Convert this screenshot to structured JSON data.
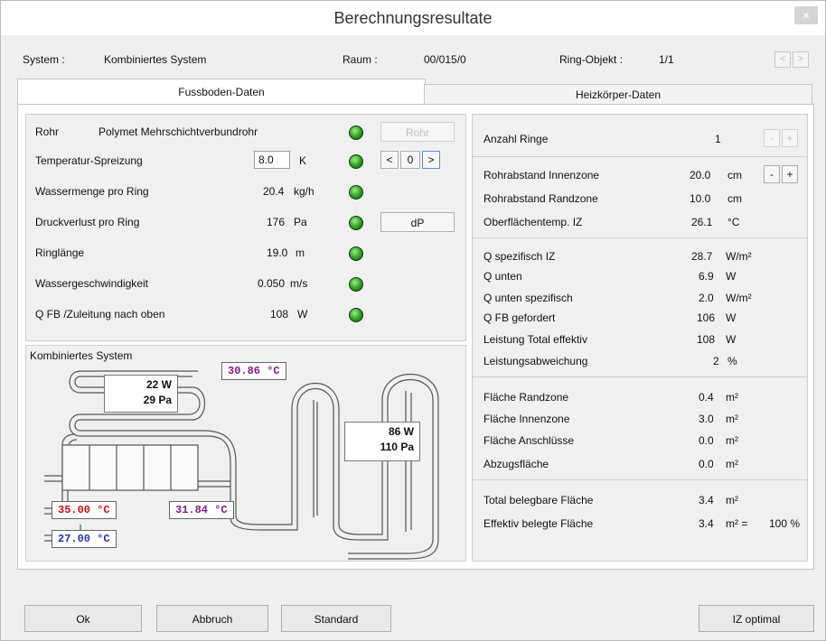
{
  "window": {
    "title": "Berechnungsresultate",
    "close_glyph": "×"
  },
  "infobar": {
    "system_label": "System :",
    "system_value": "Kombiniertes System",
    "raum_label": "Raum :",
    "raum_value": "00/015/0",
    "ring_label": "Ring-Objekt :",
    "ring_value": "1/1",
    "prev": "<",
    "next": ">"
  },
  "tabs": [
    {
      "label": "Fussboden-Daten",
      "active": true
    },
    {
      "label": "Heizkörper-Daten",
      "active": false
    }
  ],
  "left": {
    "rohr_label": "Rohr",
    "rohr_value": "Polymet Mehrschichtverbundrohr",
    "rohr_button": "Rohr",
    "temp_label": "Temperatur-Spreizung",
    "temp_value": "8.0",
    "temp_unit": "K",
    "stepper_prev": "<",
    "stepper_value": "0",
    "stepper_next": ">",
    "wasser_label": "Wassermenge pro Ring",
    "wasser_value": "20.4",
    "wasser_unit": "kg/h",
    "druck_label": "Druckverlust pro Ring",
    "druck_value": "176",
    "druck_unit": "Pa",
    "dp_button": "dP",
    "ring_label": "Ringlänge",
    "ring_value": "19.0",
    "ring_unit": "m",
    "geschw_label": "Wassergeschwindigkeit",
    "geschw_value": "0.050",
    "geschw_unit": "m/s",
    "qfb_label": "Q FB /Zuleitung nach oben",
    "qfb_value": "108",
    "qfb_unit": "W"
  },
  "diagram": {
    "title": "Kombiniertes System",
    "box1_w": "22 W",
    "box1_pa": "29 Pa",
    "box2_w": "86 W",
    "box2_pa": "110 Pa",
    "temp_top": "30.86 °C",
    "temp_supply": "35.00 °C",
    "temp_mid": "31.84 °C",
    "temp_return": "27.00 °C",
    "color_magenta": "#8a1a8a",
    "color_red": "#cc1111",
    "color_blue": "#2233aa"
  },
  "right": {
    "anzahl_label": "Anzahl Ringe",
    "anzahl_value": "1",
    "minus": "-",
    "plus": "+",
    "abstand_innen_label": "Rohrabstand Innenzone",
    "abstand_innen_value": "20.0",
    "abstand_innen_unit": "cm",
    "abstand_rand_label": "Rohrabstand Randzone",
    "abstand_rand_value": "10.0",
    "abstand_rand_unit": "cm",
    "oberfl_label": "Oberflächentemp. IZ",
    "oberfl_value": "26.1",
    "oberfl_unit": "°C",
    "q_spez_label": "Q spezifisch IZ",
    "q_spez_value": "28.7",
    "q_spez_unit": "W/m²",
    "q_unten_label": "Q unten",
    "q_unten_value": "6.9",
    "q_unten_unit": "W",
    "q_unten_spez_label": "Q unten spezifisch",
    "q_unten_spez_value": "2.0",
    "q_unten_spez_unit": "W/m²",
    "q_fb_label": "Q FB gefordert",
    "q_fb_value": "106",
    "q_fb_unit": "W",
    "leistung_label": "Leistung Total effektiv",
    "leistung_value": "108",
    "leistung_unit": "W",
    "abweichung_label": "Leistungsabweichung",
    "abweichung_value": "2",
    "abweichung_unit": "%",
    "flaeche_rand_label": "Fläche Randzone",
    "flaeche_rand_value": "0.4",
    "flaeche_rand_unit": "m²",
    "flaeche_innen_label": "Fläche Innenzone",
    "flaeche_innen_value": "3.0",
    "flaeche_innen_unit": "m²",
    "flaeche_ansch_label": "Fläche Anschlüsse",
    "flaeche_ansch_value": "0.0",
    "flaeche_ansch_unit": "m²",
    "abzug_label": "Abzugsfläche",
    "abzug_value": "0.0",
    "abzug_unit": "m²",
    "total_label": "Total belegbare Fläche",
    "total_value": "3.4",
    "total_unit": "m²",
    "eff_label": "Effektiv belegte Fläche",
    "eff_value": "3.4",
    "eff_unit": "m² =",
    "eff_percent": "100 %"
  },
  "footer": {
    "ok": "Ok",
    "abbruch": "Abbruch",
    "standard": "Standard",
    "iz_optimal": "IZ optimal"
  }
}
